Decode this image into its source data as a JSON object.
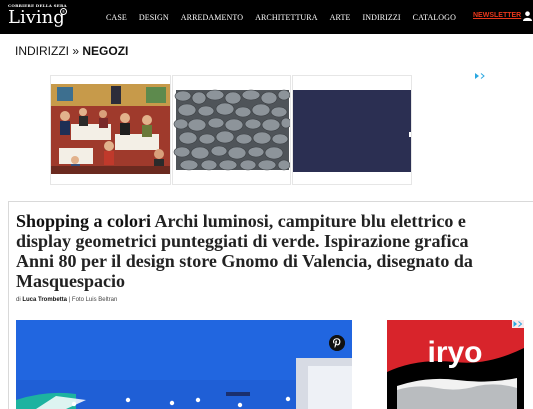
{
  "brand": {
    "kicker": "CORRIERE DELLA SERA",
    "name": "Living",
    "registered": "®"
  },
  "nav": {
    "items": [
      {
        "label": "CASE"
      },
      {
        "label": "DESIGN"
      },
      {
        "label": "ARREDAMENTO"
      },
      {
        "label": "ARCHITETTURA"
      },
      {
        "label": "ARTE"
      },
      {
        "label": "INDIRIZZI"
      },
      {
        "label": "CATALOGO"
      }
    ],
    "newsletter_label": "NEWSLETTER",
    "user_icon": "user-icon"
  },
  "breadcrumb": {
    "parent": "INDIRIZZI",
    "separator": "»",
    "current": "NEGOZI"
  },
  "ads": {
    "adchoices_icon": "adchoices-icon",
    "panels": [
      {
        "image": "illustrated-restaurant-scene"
      },
      {
        "image": "grey-pebbles-photo"
      },
      {
        "image": "navy-blue-panel"
      }
    ],
    "side_ad": {
      "brand_text": "iryo",
      "colors": {
        "red": "#d8242b",
        "white": "#ffffff",
        "black": "#000000"
      }
    }
  },
  "article": {
    "headline_lead": "Shopping a colori",
    "headline_rest": " Archi luminosi, campiture blu elettrico e display geometrici punteggiati di verde. Ispirazione grafica Anni 80 per il design store Gnomo di Valencia, disegnato da Masquespacio",
    "byline_prefix": "di ",
    "author": "Luca Trombetta",
    "photo_credit": " | Foto Luis Beltran",
    "pin_icon": "pinterest-icon"
  },
  "colors": {
    "topbar": "#000000",
    "newsletter": "#e8371b",
    "electric_blue": "#1f5fd6",
    "adchoices": "#2aa7e0"
  }
}
